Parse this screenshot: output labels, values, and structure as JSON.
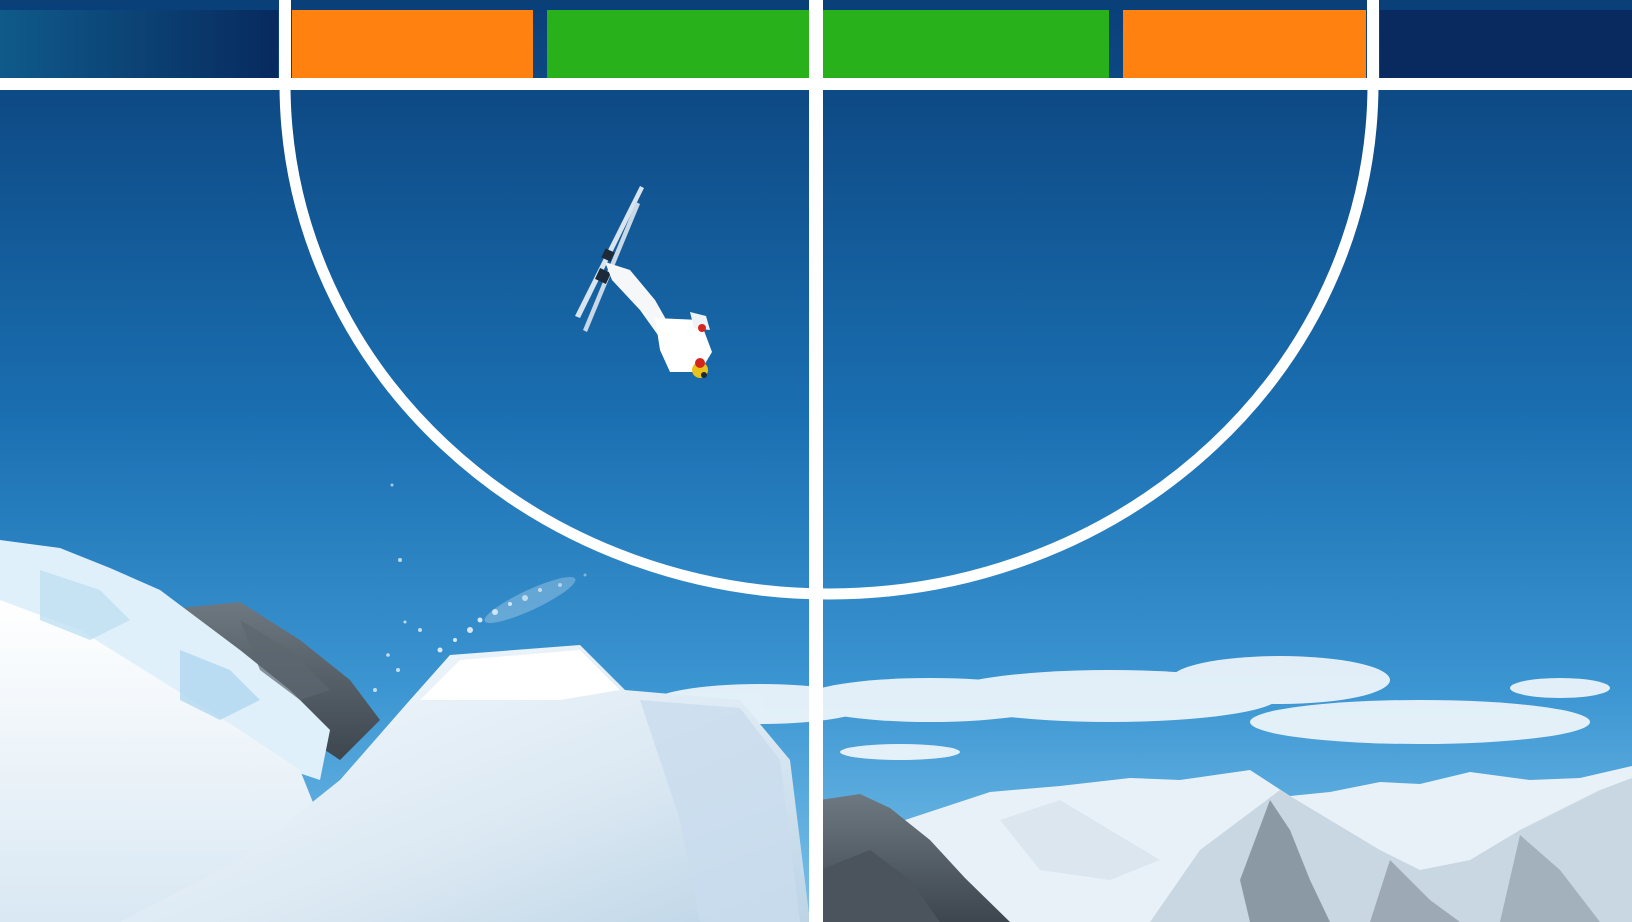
{
  "scene": {
    "subject": "freestyle-aerial-skier",
    "background": "snowy-alpine-mountains-blue-sky"
  },
  "colors": {
    "sky_top": "#0a3f78",
    "sky_mid": "#1c79bb",
    "sky_bottom": "#67b6e6",
    "snow": "#f4f8fc",
    "rock": "#55606a",
    "frame_line": "#ffffff",
    "tile_orange": "#ff8211",
    "tile_green": "#28b11a",
    "header_blue_left": "#0f5a8a",
    "header_blue_right": "#082a5e"
  },
  "overlay": {
    "tiles": [
      {
        "name": "orange",
        "color": "#ff8211"
      },
      {
        "name": "green",
        "color": "#28b11a"
      },
      {
        "name": "green",
        "color": "#28b11a"
      },
      {
        "name": "orange",
        "color": "#ff8211"
      }
    ]
  }
}
